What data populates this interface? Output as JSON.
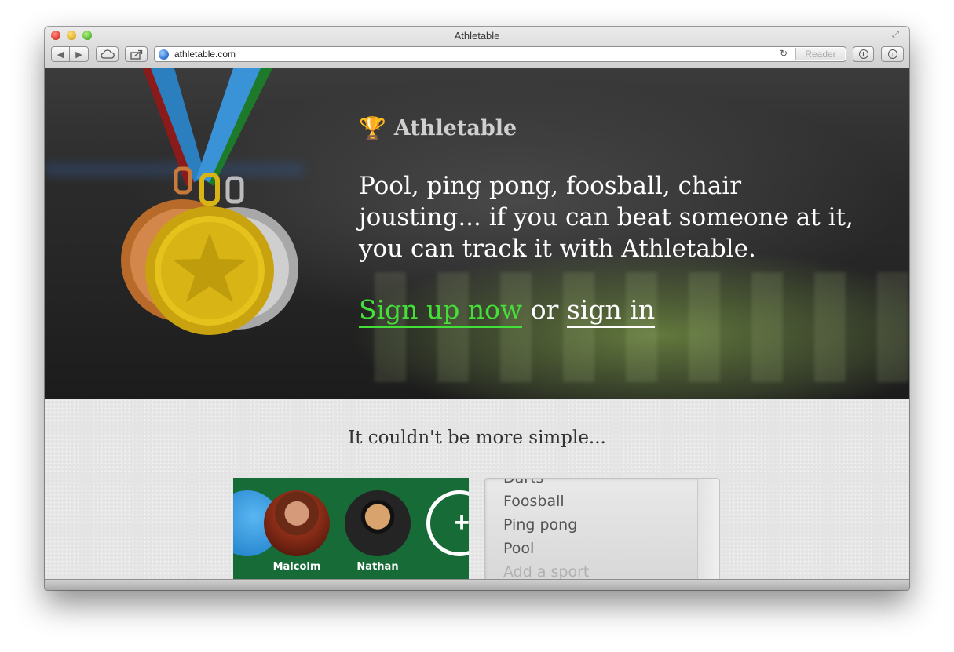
{
  "window": {
    "title": "Athletable"
  },
  "toolbar": {
    "url": "athletable.com",
    "reader_label": "Reader",
    "back_icon": "◀",
    "forward_icon": "▶",
    "reload_icon": "↻"
  },
  "hero": {
    "brand": "Athletable",
    "brand_icon": "trophy-icon",
    "tagline": "Pool, ping pong, foosball, chair jousting... if you can beat someone at it, you can track it with Athletable.",
    "signup_label": "Sign up now",
    "or_label": "or",
    "signin_label": "sign in"
  },
  "section": {
    "heading": "It couldn't be more simple..."
  },
  "players": [
    {
      "name": "Malcolm"
    },
    {
      "name": "Nathan"
    }
  ],
  "sports": {
    "items": [
      "Darts",
      "Foosball",
      "Ping pong",
      "Pool"
    ],
    "add_placeholder": "Add a sport"
  },
  "colors": {
    "signup_green": "#44e03a",
    "players_green": "#176b36",
    "trophy_gold": "#f2b21a"
  }
}
